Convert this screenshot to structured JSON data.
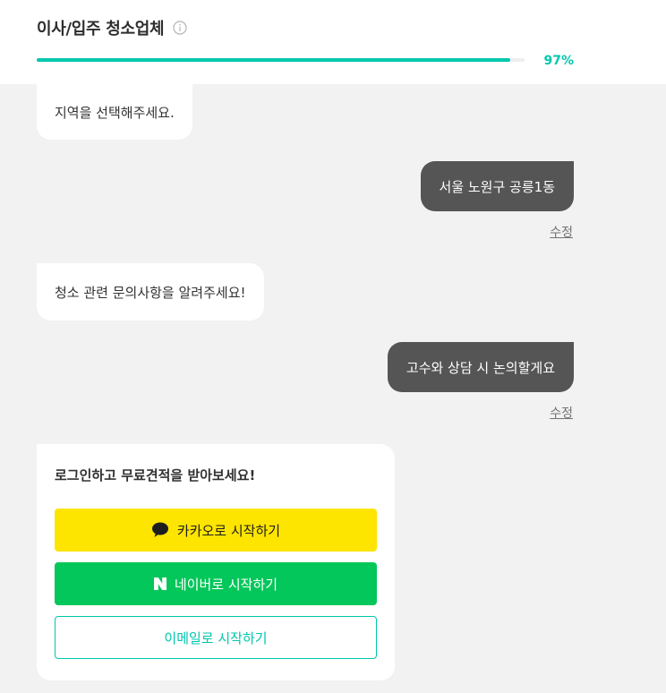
{
  "header": {
    "title": "이사/입주 청소업체",
    "info_icon": "info-circle-icon",
    "progress_percent": 97,
    "progress_label": "97%",
    "accent_color": "#00c7ae"
  },
  "chat": {
    "messages": [
      {
        "from": "bot",
        "text": "지역을 선택해주세요."
      },
      {
        "from": "user",
        "text": "서울 노원구 공릉1동",
        "edit_label": "수정"
      },
      {
        "from": "bot",
        "text": "청소 관련 문의사항을 알려주세요!"
      },
      {
        "from": "user",
        "text": "고수와 상담 시 논의할게요",
        "edit_label": "수정"
      }
    ]
  },
  "login": {
    "title": "로그인하고 무료견적을 받아보세요!",
    "kakao": {
      "label": "카카오로 시작하기",
      "icon": "kakao-speech-bubble-icon",
      "color": "#fee500"
    },
    "naver": {
      "label": "네이버로 시작하기",
      "icon": "naver-n-icon",
      "color": "#03c75a"
    },
    "email": {
      "label": "이메일로 시작하기"
    }
  }
}
